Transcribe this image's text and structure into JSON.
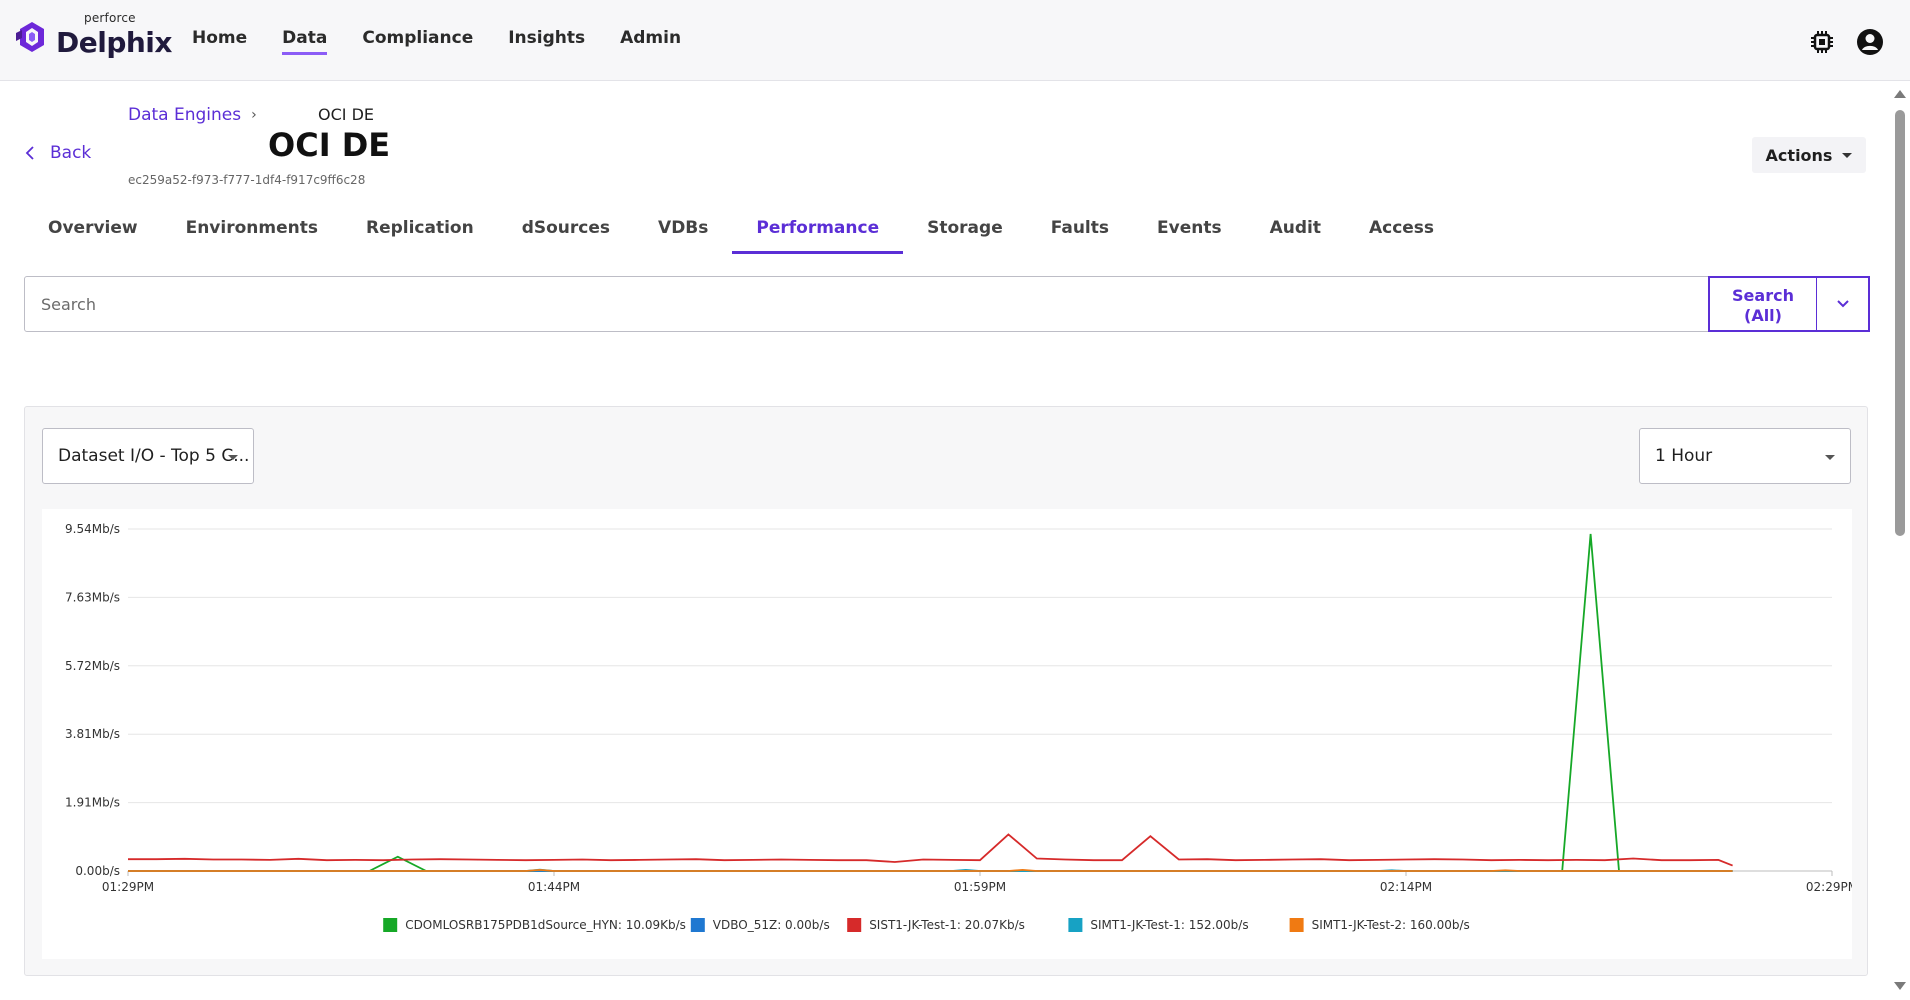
{
  "brand": {
    "small": "perforce",
    "name": "Delphix"
  },
  "nav": [
    {
      "label": "Home"
    },
    {
      "label": "Data"
    },
    {
      "label": "Compliance"
    },
    {
      "label": "Insights"
    },
    {
      "label": "Admin"
    }
  ],
  "back_label": "Back",
  "breadcrumb": {
    "parent": "Data Engines",
    "current": "OCI DE"
  },
  "page": {
    "title": "OCI DE",
    "id": "ec259a52-f973-f777-1df4-f917c9ff6c28"
  },
  "actions_label": "Actions",
  "tabs": [
    {
      "label": "Overview"
    },
    {
      "label": "Environments"
    },
    {
      "label": "Replication"
    },
    {
      "label": "dSources"
    },
    {
      "label": "VDBs"
    },
    {
      "label": "Performance"
    },
    {
      "label": "Storage"
    },
    {
      "label": "Faults"
    },
    {
      "label": "Events"
    },
    {
      "label": "Audit"
    },
    {
      "label": "Access"
    }
  ],
  "active_tab": "Performance",
  "search": {
    "placeholder": "Search",
    "button_line1": "Search",
    "button_line2": "(All)"
  },
  "metric_select": "Dataset I/O - Top 5 C...",
  "range_select": "1 Hour",
  "colors": {
    "accent": "#5b2ed6",
    "nav_underline": "#8b5cf6"
  },
  "chart_data": {
    "type": "line",
    "y_ticks": [
      "0.00b/s",
      "1.91Mb/s",
      "3.81Mb/s",
      "5.72Mb/s",
      "7.63Mb/s",
      "9.54Mb/s"
    ],
    "x_ticks": [
      "01:29PM",
      "01:44PM",
      "01:59PM",
      "02:14PM",
      "02:29PM"
    ],
    "ylim": [
      0,
      9.54
    ],
    "y_unit": "Mb/s",
    "x_minutes_range": [
      0,
      60
    ],
    "grid": true,
    "legend_position": "bottom",
    "series": [
      {
        "name": "CDOMLOSRB175PDB1dSource_HYN: 10.09Kb/s",
        "color": "#16a827",
        "points": [
          [
            0,
            0
          ],
          [
            8.5,
            0
          ],
          [
            9.5,
            0.4
          ],
          [
            10.5,
            0
          ],
          [
            50.5,
            0
          ],
          [
            51.5,
            9.4
          ],
          [
            52.5,
            0
          ],
          [
            56.5,
            0
          ]
        ]
      },
      {
        "name": "VDBO_51Z: 0.00b/s",
        "color": "#1f78d1",
        "points": [
          [
            0,
            0
          ],
          [
            56.5,
            0
          ]
        ]
      },
      {
        "name": "SIST1-JK-Test-1: 20.07Kb/s",
        "color": "#d62a2a",
        "points": [
          [
            0,
            0.33
          ],
          [
            1,
            0.33
          ],
          [
            2,
            0.34
          ],
          [
            3,
            0.32
          ],
          [
            4,
            0.32
          ],
          [
            5,
            0.31
          ],
          [
            6,
            0.34
          ],
          [
            7,
            0.3
          ],
          [
            8,
            0.31
          ],
          [
            9,
            0.3
          ],
          [
            10,
            0.32
          ],
          [
            11,
            0.33
          ],
          [
            12,
            0.32
          ],
          [
            13,
            0.31
          ],
          [
            14,
            0.3
          ],
          [
            15,
            0.31
          ],
          [
            16,
            0.32
          ],
          [
            17,
            0.3
          ],
          [
            18,
            0.31
          ],
          [
            19,
            0.32
          ],
          [
            20,
            0.33
          ],
          [
            21,
            0.3
          ],
          [
            22,
            0.31
          ],
          [
            23,
            0.32
          ],
          [
            24,
            0.31
          ],
          [
            25,
            0.3
          ],
          [
            26,
            0.3
          ],
          [
            27,
            0.25
          ],
          [
            28,
            0.32
          ],
          [
            29,
            0.31
          ],
          [
            30,
            0.3
          ],
          [
            31,
            1.02
          ],
          [
            32,
            0.35
          ],
          [
            33,
            0.32
          ],
          [
            34,
            0.3
          ],
          [
            35,
            0.3
          ],
          [
            36,
            0.97
          ],
          [
            37,
            0.32
          ],
          [
            38,
            0.33
          ],
          [
            39,
            0.3
          ],
          [
            40,
            0.31
          ],
          [
            41,
            0.32
          ],
          [
            42,
            0.33
          ],
          [
            43,
            0.3
          ],
          [
            44,
            0.31
          ],
          [
            45,
            0.32
          ],
          [
            46,
            0.33
          ],
          [
            47,
            0.32
          ],
          [
            48,
            0.3
          ],
          [
            49,
            0.31
          ],
          [
            50,
            0.3
          ],
          [
            51,
            0.31
          ],
          [
            52,
            0.3
          ],
          [
            53,
            0.35
          ],
          [
            54,
            0.3
          ],
          [
            55,
            0.3
          ],
          [
            56,
            0.31
          ],
          [
            56.5,
            0.15
          ]
        ]
      },
      {
        "name": "SIMT1-JK-Test-1: 152.00b/s",
        "color": "#17a2c4",
        "points": [
          [
            0,
            0
          ],
          [
            14,
            0
          ],
          [
            14.5,
            0.04
          ],
          [
            15,
            0
          ],
          [
            29,
            0
          ],
          [
            29.5,
            0.03
          ],
          [
            30,
            0
          ],
          [
            44,
            0
          ],
          [
            44.5,
            0.02
          ],
          [
            45,
            0
          ],
          [
            56.5,
            0
          ]
        ]
      },
      {
        "name": "SIMT1-JK-Test-2: 160.00b/s",
        "color": "#f07a12",
        "points": [
          [
            0,
            0
          ],
          [
            14,
            0
          ],
          [
            14.5,
            0.03
          ],
          [
            15,
            0
          ],
          [
            31,
            0
          ],
          [
            31.5,
            0.03
          ],
          [
            32,
            0
          ],
          [
            48,
            0
          ],
          [
            48.5,
            0.02
          ],
          [
            49,
            0
          ],
          [
            56.5,
            0
          ]
        ]
      }
    ]
  }
}
